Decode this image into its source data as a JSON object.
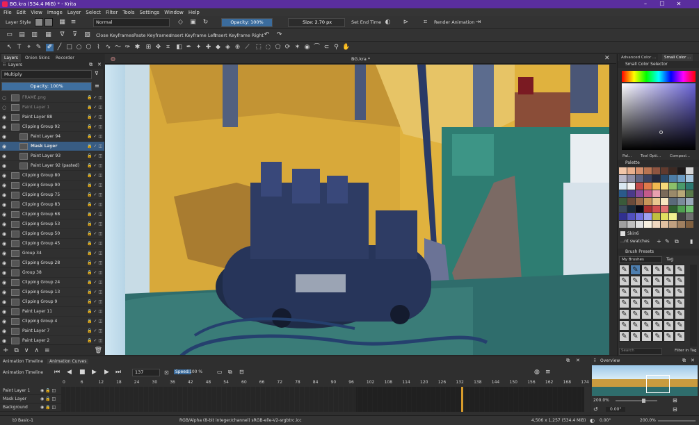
{
  "window": {
    "title": "BG.kra (534.4 MiB)  * - Krita",
    "controls": [
      "–",
      "☐",
      "✕"
    ]
  },
  "menu": [
    "File",
    "Edit",
    "View",
    "Image",
    "Layer",
    "Select",
    "Filter",
    "Tools",
    "Settings",
    "Window",
    "Help"
  ],
  "toolbar1": {
    "layer_style": "Layer Style",
    "blend_mode": "Normal",
    "opacity": "Opacity: 100%",
    "size": "Size: 2.70 px",
    "set_end_time": "Set End Time",
    "render_animation": "Render Animation"
  },
  "toolbar2": {
    "close_keyframes": "Close Keyframes",
    "paste_keyframes": "Paste Keyframes",
    "insert_left": "Insert Keyframe Left",
    "insert_right": "Insert Keyframe Right"
  },
  "left_dock": {
    "tabs": [
      "Layers",
      "Onion Skins",
      "Recorder"
    ],
    "panel_title": "Layers",
    "blend_mode": "Multiply",
    "opacity": "Opacity:  100%",
    "layers": [
      {
        "name": "FRAME.png",
        "indent": 0,
        "faded": true
      },
      {
        "name": "Paint Layer 1",
        "indent": 0,
        "faded": true
      },
      {
        "name": "Paint Layer 88",
        "indent": 0
      },
      {
        "name": "Clipping Group 92",
        "indent": 0
      },
      {
        "name": "Paint Layer 94",
        "indent": 1
      },
      {
        "name": "Mask Layer",
        "indent": 1,
        "selected": true
      },
      {
        "name": "Paint Layer 93",
        "indent": 1
      },
      {
        "name": "Paint Layer 92 (pasted)",
        "indent": 1
      },
      {
        "name": "Clipping Group 80",
        "indent": 0
      },
      {
        "name": "Clipping Group 90",
        "indent": 0
      },
      {
        "name": "Clipping Group 75",
        "indent": 0
      },
      {
        "name": "Clipping Group 83",
        "indent": 0
      },
      {
        "name": "Clipping Group 68",
        "indent": 0
      },
      {
        "name": "Clipping Group 53",
        "indent": 0
      },
      {
        "name": "Clipping Group 50",
        "indent": 0
      },
      {
        "name": "Clipping Group 45",
        "indent": 0
      },
      {
        "name": "Group 34",
        "indent": 0
      },
      {
        "name": "Clipping Group 28",
        "indent": 0
      },
      {
        "name": "Group 38",
        "indent": 0
      },
      {
        "name": "Clipping Group 24",
        "indent": 0
      },
      {
        "name": "Clipping Group 13",
        "indent": 0
      },
      {
        "name": "Clipping Group 9",
        "indent": 0
      },
      {
        "name": "Paint Layer 11",
        "indent": 0
      },
      {
        "name": "Clipping Group 4",
        "indent": 0
      },
      {
        "name": "Paint Layer 7",
        "indent": 0
      },
      {
        "name": "Paint Layer 2",
        "indent": 0
      }
    ]
  },
  "canvas": {
    "document_tab": "BG.kra *"
  },
  "right_dock": {
    "top_tabs": [
      "Advanced Color ...",
      "Small Color ..."
    ],
    "color_selector_title": "Small Color Selector",
    "mid_tabs": [
      "Pal...",
      "Tool Opti...",
      "Composi..."
    ],
    "palette_title": "Palette",
    "palette_name": "Skin6",
    "swatch_label": "...nt swatches",
    "brush_presets_title": "Brush Presets",
    "brush_filter": "My Brushes",
    "tag_label": "Tag",
    "search_placeholder": "Search",
    "filter_in_tag": "Filter in Tag"
  },
  "timeline": {
    "tabs": [
      "Animation Timeline",
      "Animation Curves"
    ],
    "title": "Animation Timeline",
    "frame": "137",
    "speed_label": "Speed:",
    "speed": "100 %",
    "ticks": [
      "0",
      "6",
      "12",
      "18",
      "24",
      "30",
      "36",
      "42",
      "48",
      "54",
      "60",
      "66",
      "72",
      "78",
      "84",
      "90",
      "96",
      "102",
      "108",
      "114",
      "120",
      "126",
      "132",
      "138",
      "144",
      "150",
      "156",
      "162",
      "168",
      "174"
    ],
    "layers": [
      "Paint Layer 1",
      "Mask Layer",
      "Background"
    ]
  },
  "overview": {
    "title": "Overview",
    "zoom": "200.0%",
    "rotation": "0.00°"
  },
  "status": {
    "brush": "b) Basic-1",
    "color_info": "RGB/Alpha (8-bit integer/channel)  sRGB-elle-V2-srgbtrc.icc",
    "dims": "4,506 x 1,257 (534.4 MiB)",
    "angle": "0.00°",
    "zoom": "200.0%"
  },
  "colors": {
    "titlebar": "#5a2e9e",
    "selection": "#385c83",
    "accent": "#3b6c9d"
  }
}
